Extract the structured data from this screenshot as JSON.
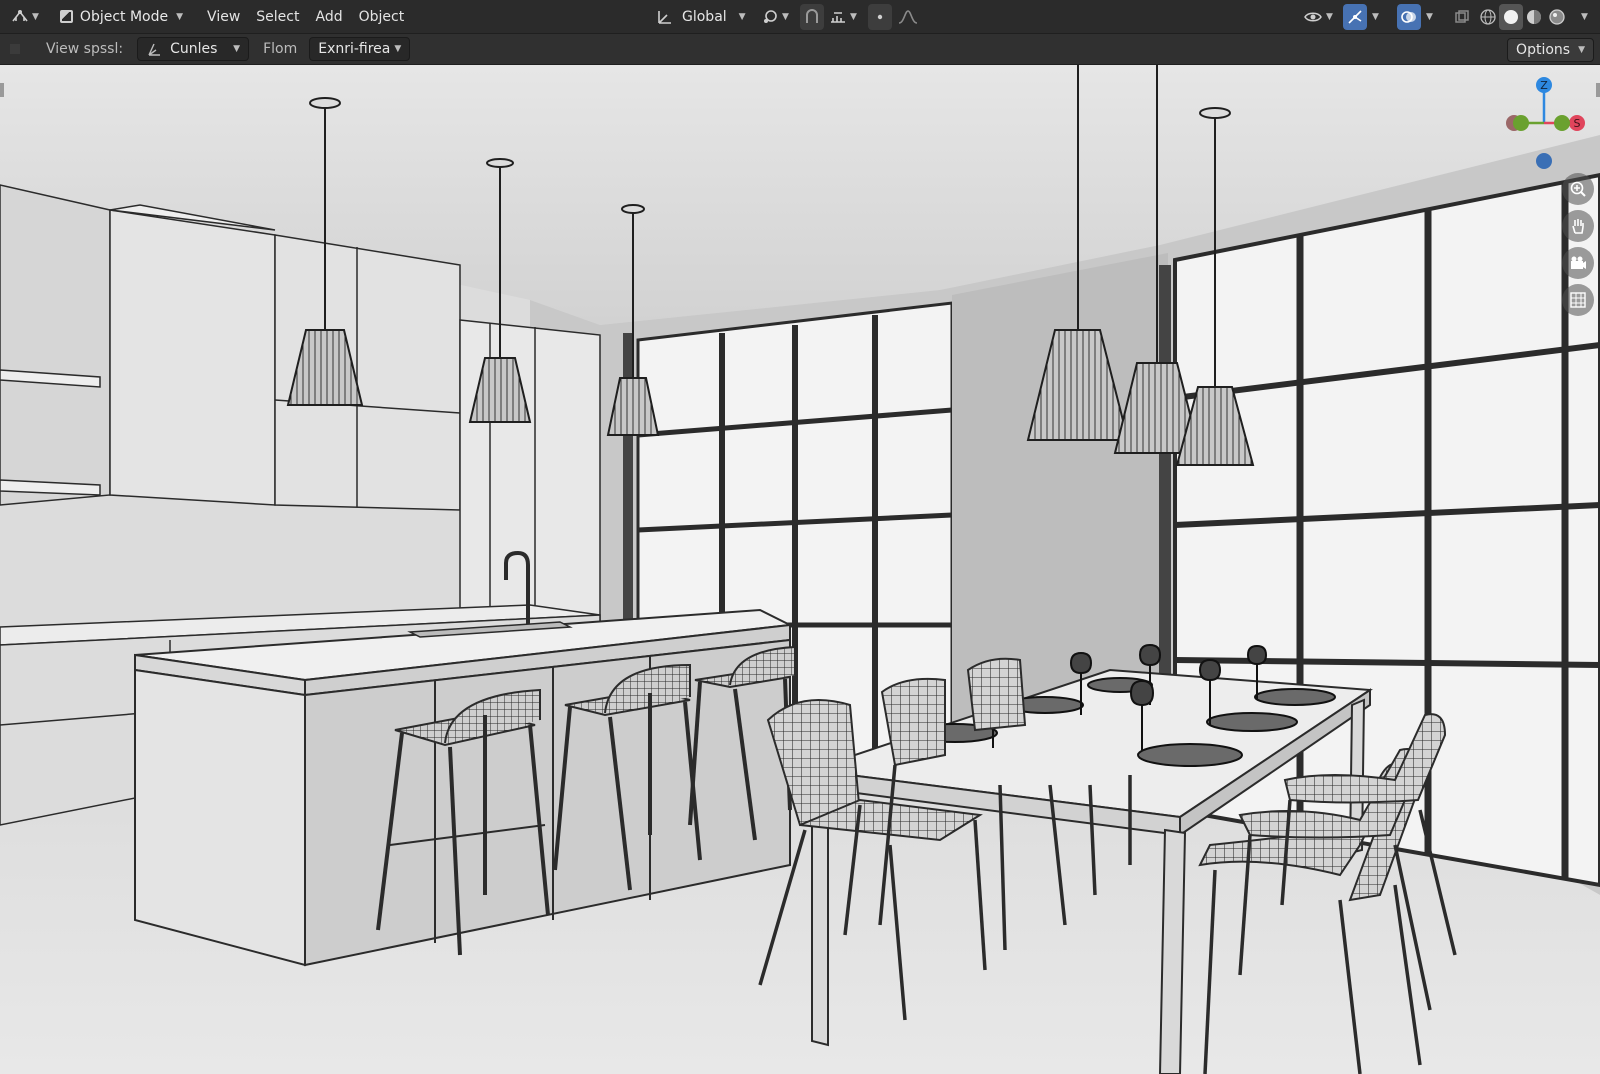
{
  "header": {
    "editor_type_icon": "view3d-editor-icon",
    "mode_label": "Object Mode",
    "menus": [
      "View",
      "Select",
      "Add",
      "Object"
    ],
    "transform_orientation": "Global",
    "icons": [
      "transform-orientation-icon",
      "pivot-point-icon",
      "snap-icon",
      "snap-increment-icon",
      "proportional-editing-icon",
      "falloff-icon",
      "visibility-icon",
      "gizmo-toggle-icon",
      "overlay-toggle-icon",
      "xray-icon",
      "wireframe-shading-icon",
      "solid-shading-icon",
      "material-shading-icon",
      "rendered-shading-icon"
    ]
  },
  "subheader": {
    "view_label": "View spssl:",
    "view_value": "Cunles",
    "from_label": "Flom",
    "from_value": "Exnri-firea",
    "options_label": "Options"
  },
  "gizmo": {
    "z_label": "Z",
    "x_label": "S",
    "colors": {
      "z": "#2d88e0",
      "x": "#e0455c",
      "y": "#6aa12f",
      "neg": "#3a6fb5"
    }
  },
  "viewport": {
    "scene_description_hidden": true
  },
  "navigation_icons": [
    "zoom-icon",
    "pan-hand-icon",
    "camera-view-icon",
    "ortho-grid-icon"
  ]
}
